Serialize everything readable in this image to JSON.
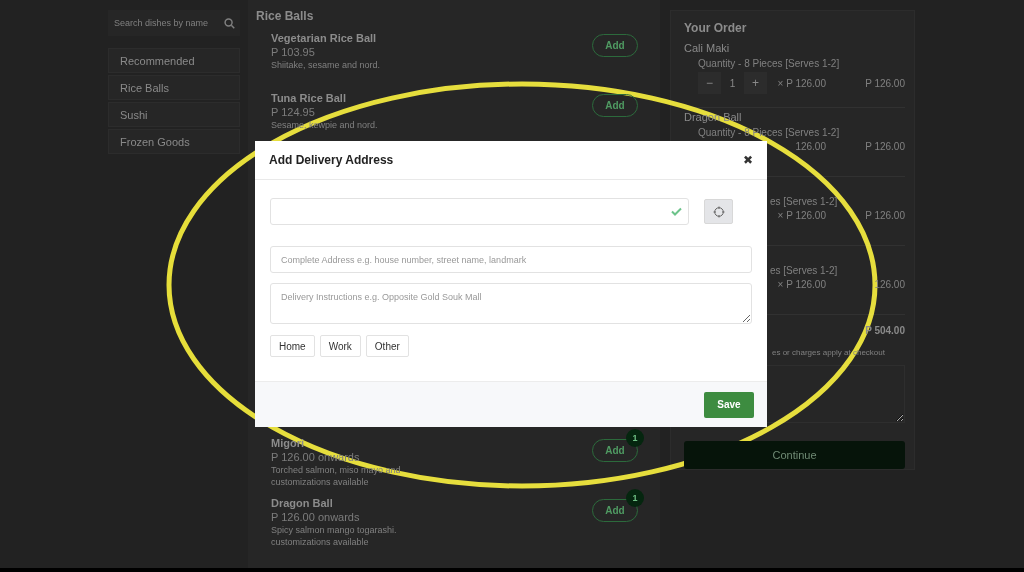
{
  "sidebar": {
    "search": {
      "placeholder": "Search dishes by name"
    },
    "categories": [
      "Recommended",
      "Rice Balls",
      "Sushi",
      "Frozen Goods"
    ]
  },
  "menu": {
    "heading": "Rice Balls",
    "items": [
      {
        "name": "Vegetarian Rice Ball",
        "price": "P 103.95",
        "description": "Shiitake, sesame and nord.",
        "add": "Add"
      },
      {
        "name": "Tuna Rice Ball",
        "price": "P 124.95",
        "description": "Sesame, kewpie and nord.",
        "add": "Add"
      },
      {
        "name": "Migori",
        "price": "P 126.00 onwards",
        "description": "Torched salmon, miso mayo and",
        "note": "customizations available",
        "add": "Add",
        "badge": "1"
      },
      {
        "name": "Dragon Ball",
        "price": "P 126.00 onwards",
        "description": "Spicy salmon mango togarashi.",
        "note": "customizations available",
        "add": "Add",
        "badge": "1"
      }
    ]
  },
  "order": {
    "title": "Your Order",
    "items": [
      {
        "name": "Cali Maki",
        "quantity": "Quantity - 8 Pieces [Serves 1-2]",
        "stepper": {
          "minus": "−",
          "count": "1",
          "plus": "+"
        },
        "unit_price": "× P 126.00",
        "total": "P 126.00"
      },
      {
        "name": "Dragon Ball",
        "quantity": "Quantity - 8 Pieces [Serves 1-2]",
        "unit_price": "126.00",
        "total": "P 126.00"
      },
      {
        "quantity": "es [Serves 1-2]",
        "unit_price": "× P 126.00",
        "total": "P 126.00"
      },
      {
        "quantity": "es [Serves 1-2]",
        "unit_price": "× P 126.00",
        "total": "126.00"
      }
    ],
    "subtotal": "P 504.00",
    "note": "es or charges apply at checkout",
    "continue": "Continue"
  },
  "modal": {
    "title": "Add Delivery Address",
    "close": "✖",
    "location_field": {
      "valid": true
    },
    "address_field": {
      "placeholder": "Complete Address e.g. house number, street name, landmark"
    },
    "instructions_field": {
      "placeholder": "Delivery Instructions e.g. Opposite Gold Souk Mall"
    },
    "tags": [
      {
        "label": "Home",
        "selected": false
      },
      {
        "label": "Work",
        "selected": false
      },
      {
        "label": "Other",
        "selected": false
      }
    ],
    "save": "Save"
  }
}
